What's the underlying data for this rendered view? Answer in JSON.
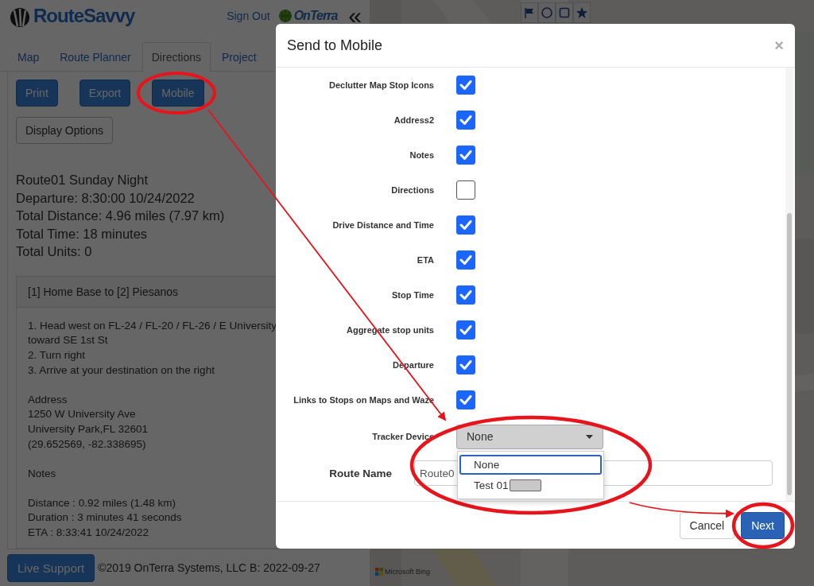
{
  "app": {
    "logo": "RouteSavvy",
    "sign_out": "Sign Out",
    "brand": "OnTerra",
    "collapse": "«"
  },
  "tabs": [
    {
      "label": "Map",
      "selected": false
    },
    {
      "label": "Route Planner",
      "selected": false
    },
    {
      "label": "Directions",
      "selected": true
    },
    {
      "label": "Project",
      "selected": false
    }
  ],
  "actions": [
    "Print",
    "Export",
    "Mobile"
  ],
  "display_options": "Display Options",
  "summary": [
    "Route01 Sunday Night",
    "Departure: 8:30:00 10/24/2022",
    "Total Distance: 4.96 miles (7.97 km)",
    "Total Time: 18 minutes",
    "Total Units: 0"
  ],
  "leg": {
    "title": "[1] Home Base to [2] Piesanos",
    "steps": [
      "1. Head west on FL-24 / FL-20 / FL-26 / E University",
      "toward SE 1st St",
      "2. Turn right",
      "3. Arrive at your destination on the right"
    ],
    "address_label": "Address",
    "address": [
      "1250 W University Ave",
      "University Park,FL 32601",
      "(29.652569, -82.338695)"
    ],
    "notes_label": "Notes",
    "stats": [
      "Distance : 0.92 miles (1.48 km)",
      "Duration : 3 minutes 41 seconds",
      "ETA : 8:33:41 10/24/2022"
    ]
  },
  "footer": {
    "button": "Live Support",
    "copyright": "©2019 OnTerra Systems, LLC B: 2022-09-27"
  },
  "map": {
    "toolbar": [
      {
        "kind": "flag"
      },
      {
        "kind": "circle"
      },
      {
        "kind": "square"
      },
      {
        "kind": "star"
      }
    ],
    "attribution": "Microsoft Bing"
  },
  "modal": {
    "title": "Send to Mobile",
    "close": "×",
    "options": [
      {
        "label": "Declutter Map Stop Icons",
        "checked": true
      },
      {
        "label": "Address2",
        "checked": true
      },
      {
        "label": "Notes",
        "checked": true
      },
      {
        "label": "Directions",
        "checked": false
      },
      {
        "label": "Drive Distance and Time",
        "checked": true
      },
      {
        "label": "ETA",
        "checked": true
      },
      {
        "label": "Stop Time",
        "checked": true
      },
      {
        "label": "Aggregate stop units",
        "checked": true
      },
      {
        "label": "Departure",
        "checked": true
      },
      {
        "label": "Links to Stops on Maps and Waze",
        "checked": true
      }
    ],
    "tracker": {
      "label": "Tracker Device",
      "value": "None",
      "expanded": true,
      "options": [
        {
          "label": "None",
          "selected": true,
          "redacted": false
        },
        {
          "label": "Test 01",
          "selected": false,
          "redacted": true
        }
      ]
    },
    "route_name": {
      "label": "Route Name",
      "value": "Route0"
    },
    "buttons": [
      {
        "label": "Cancel",
        "kind": "default"
      },
      {
        "label": "Next",
        "kind": "primary"
      }
    ]
  },
  "annotations_shown": true
}
